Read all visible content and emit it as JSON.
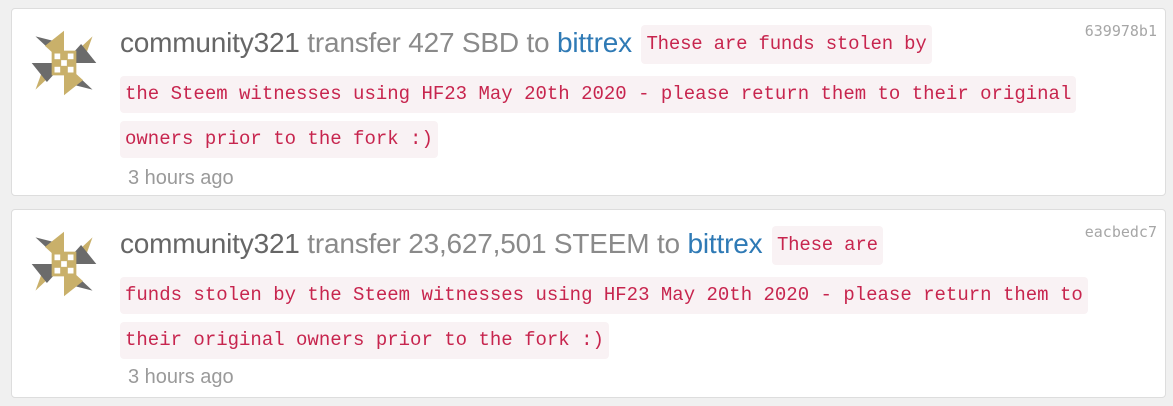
{
  "transfers": [
    {
      "hash": "639978b1",
      "user": "community321",
      "action": "transfer",
      "amount": "427 SBD",
      "to_word": "to",
      "recipient": "bittrex",
      "memo_lines": [
        "These are funds stolen by",
        "the Steem witnesses using HF23 May 20th 2020 - please return them to their original",
        "owners prior to the fork :)"
      ],
      "time": "3 hours ago"
    },
    {
      "hash": "eacbedc7",
      "user": "community321",
      "action": "transfer",
      "amount": "23,627,501 STEEM",
      "to_word": "to",
      "recipient": "bittrex",
      "memo_lines": [
        "These are",
        "funds stolen by the Steem witnesses using HF23 May 20th 2020 - please return them to",
        "their original owners prior to the fork :)"
      ],
      "time": "3 hours ago"
    }
  ],
  "colors": {
    "link": "#2f7ab5",
    "memo_text": "#c7254e",
    "memo_bg": "#f9f2f4",
    "avatar_gold": "#c9b06a",
    "avatar_gray": "#6b6b6b"
  }
}
